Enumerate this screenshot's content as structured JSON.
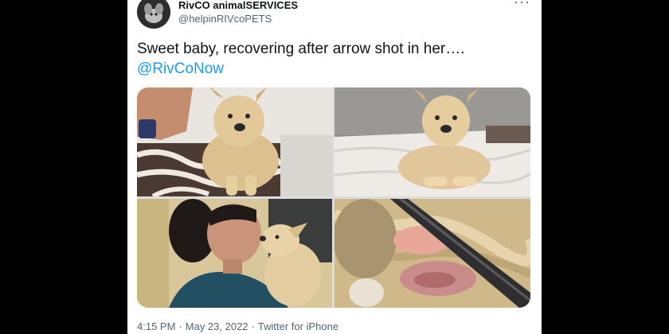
{
  "tweet": {
    "display_name": "RivCO animalSERVICES",
    "handle": "@helpinRIVcoPETS",
    "more_icon": "ellipsis-icon",
    "text": "Sweet baby, recovering after arrow shot in her….",
    "mention": "@RivCoNow",
    "mention_color": "#1d9bf0",
    "time": "4:15 PM",
    "date": "May 23, 2022",
    "separator": "·",
    "source": "Twitter for iPhone"
  }
}
